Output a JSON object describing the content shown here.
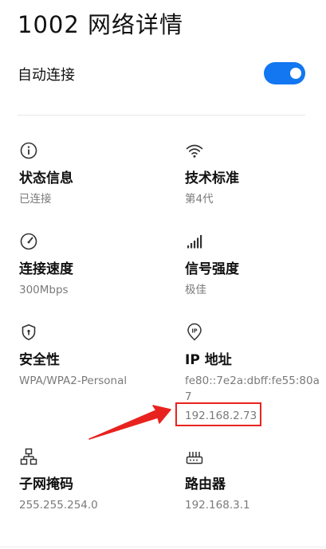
{
  "header": {
    "title": "1002 网络详情"
  },
  "auto_connect": {
    "label": "自动连接",
    "enabled": true,
    "accent": "#1277f0"
  },
  "details": {
    "status": {
      "label": "状态信息",
      "value": "已连接",
      "icon": "info-circle-icon"
    },
    "standard": {
      "label": "技术标准",
      "value": "第4代",
      "icon": "wifi-icon"
    },
    "speed": {
      "label": "连接速度",
      "value": "300Mbps",
      "icon": "speedometer-icon"
    },
    "signal": {
      "label": "信号强度",
      "value": "极佳",
      "icon": "signal-bars-icon"
    },
    "security": {
      "label": "安全性",
      "value": "WPA/WPA2-Personal",
      "icon": "shield-icon"
    },
    "ip": {
      "label": "IP 地址",
      "ipv6": "fe80::7e2a:dbff:fe55:80a7",
      "ipv4": "192.168.2.73",
      "icon": "ip-pin-icon",
      "icon_text": "IP"
    },
    "subnet": {
      "label": "子网掩码",
      "value": "255.255.254.0",
      "icon": "network-topology-icon"
    },
    "router": {
      "label": "路由器",
      "value": "192.168.3.1",
      "icon": "router-icon"
    }
  },
  "annotation": {
    "color": "#e8231f"
  }
}
